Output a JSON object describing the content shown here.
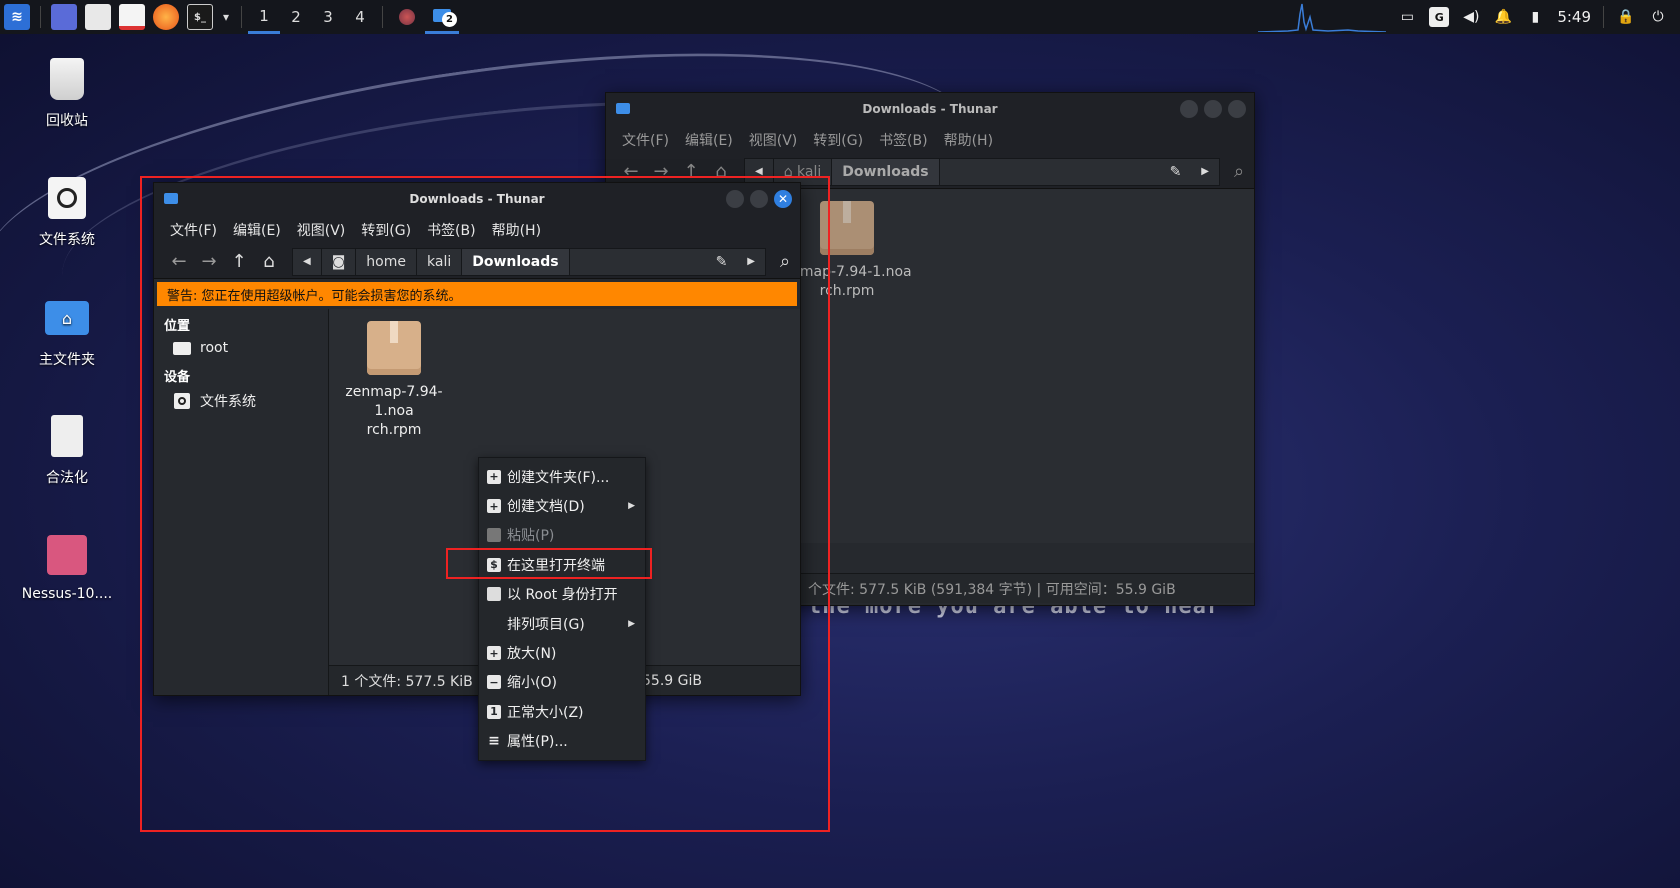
{
  "desktop": {
    "bg_text": "the more you are able to hear",
    "icons": [
      {
        "label": "回收站",
        "icon": "trash-icon"
      },
      {
        "label": "文件系统",
        "icon": "drive-icon"
      },
      {
        "label": "主文件夹",
        "icon": "home-folder-icon"
      },
      {
        "label": "合法化",
        "icon": "document-icon"
      },
      {
        "label": "Nessus-10....",
        "icon": "package-icon"
      }
    ]
  },
  "taskbar": {
    "workspaces": [
      "1",
      "2",
      "3",
      "4"
    ],
    "active_workspace": "1",
    "thunar_badge": "2",
    "clock": "5:49",
    "terminal_glyph": "$_",
    "dropdown_glyph": "▾",
    "dragon_glyph": "≋"
  },
  "back_window": {
    "title": "Downloads - Thunar",
    "menu": [
      "文件(F)",
      "编辑(E)",
      "视图(V)",
      "转到(G)",
      "书签(B)",
      "帮助(H)"
    ],
    "crumbs": [
      "kali",
      "Downloads"
    ],
    "file_name": "zenmap-7.94-1.noarch.rpm",
    "file_line1": "enmap-7.94-1.noa",
    "file_line2": "rch.rpm",
    "status": "个文件: 577.5 KiB (591,384 字节) | 可用空间：55.9 GiB"
  },
  "front_window": {
    "title": "Downloads - Thunar",
    "menu": [
      "文件(F)",
      "编辑(E)",
      "视图(V)",
      "转到(G)",
      "书签(B)",
      "帮助(H)"
    ],
    "crumbs": [
      "home",
      "kali",
      "Downloads"
    ],
    "warning": "警告: 您正在使用超级帐户。可能会损害您的系统。",
    "sidebar": {
      "places_header": "位置",
      "places": [
        {
          "label": "root",
          "icon": "folder-icon"
        }
      ],
      "devices_header": "设备",
      "devices": [
        {
          "label": "文件系统",
          "icon": "drive-icon"
        }
      ]
    },
    "file_line1": "zenmap-7.94-1.noa",
    "file_line2": "rch.rpm",
    "status_left": "1 个文件: 577.5 KiB (5",
    "status_right": "55.9 GiB"
  },
  "context_menu": {
    "items": [
      {
        "label": "创建文件夹(F)...",
        "icon": "+",
        "enabled": true,
        "submenu": false
      },
      {
        "label": "创建文档(D)",
        "icon": "+",
        "enabled": true,
        "submenu": true
      },
      {
        "label": "粘贴(P)",
        "icon": "",
        "enabled": false,
        "submenu": false
      },
      {
        "label": "在这里打开终端",
        "icon": "$",
        "enabled": true,
        "submenu": false
      },
      {
        "label": "以 Root 身份打开",
        "icon": "",
        "enabled": true,
        "submenu": false
      },
      {
        "label": "排列项目(G)",
        "icon": "",
        "enabled": true,
        "submenu": true
      },
      {
        "label": "放大(N)",
        "icon": "+",
        "enabled": true,
        "submenu": false
      },
      {
        "label": "缩小(O)",
        "icon": "−",
        "enabled": true,
        "submenu": false
      },
      {
        "label": "正常大小(Z)",
        "icon": "1",
        "enabled": true,
        "submenu": false
      },
      {
        "label": "属性(P)...",
        "icon": "≡",
        "enabled": true,
        "submenu": false
      }
    ]
  },
  "colors": {
    "accent": "#2f7fe0",
    "warning_bg": "#ff8700",
    "annotation_red": "#ee2222"
  }
}
